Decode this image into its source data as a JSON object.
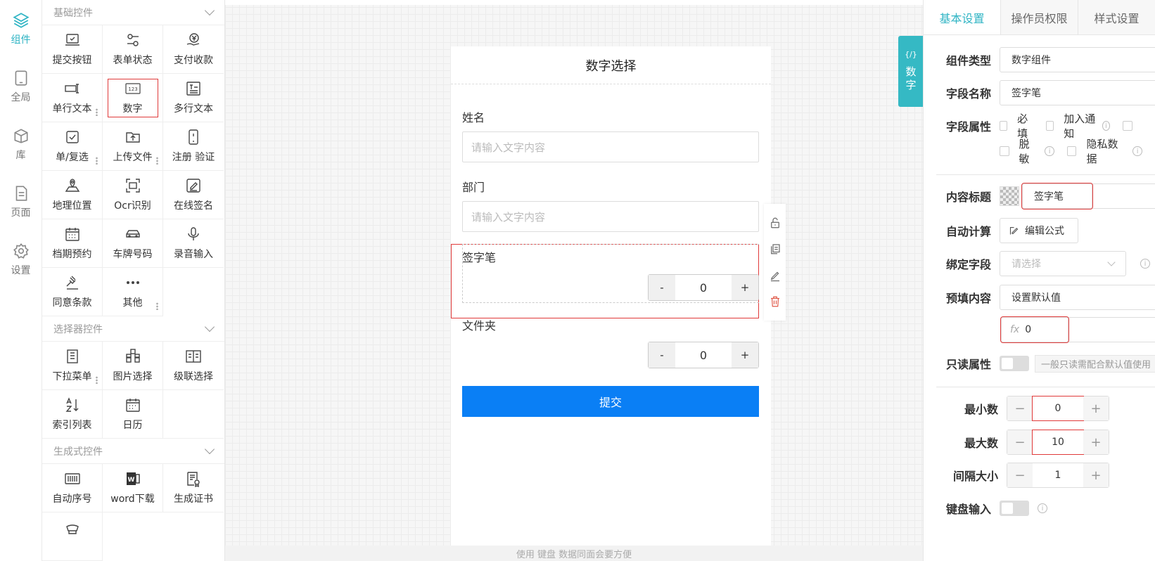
{
  "rail": [
    {
      "label": "组件",
      "icon": "layers-icon",
      "active": true
    },
    {
      "label": "全局",
      "icon": "tablet-icon"
    },
    {
      "label": "库",
      "icon": "box-icon"
    },
    {
      "label": "页面",
      "icon": "file-icon"
    },
    {
      "label": "设置",
      "icon": "gear-icon"
    }
  ],
  "palette": {
    "basic_title": "基础控件",
    "basic": [
      "提交按钮",
      "表单状态",
      "支付收款",
      "单行文本",
      "数字",
      "多行文本",
      "单/复选",
      "上传文件",
      "注册 验证",
      "地理位置",
      "Ocr识别",
      "在线签名",
      "档期预约",
      "车牌号码",
      "录音输入",
      "同意条款",
      "其他"
    ],
    "selector_title": "选择器控件",
    "selector": [
      "下拉菜单",
      "图片选择",
      "级联选择",
      "索引列表",
      "日历"
    ],
    "gen_title": "生成式控件",
    "gen": [
      "自动序号",
      "word下载",
      "生成证书"
    ]
  },
  "form": {
    "title": "数字选择",
    "field1_label": "姓名",
    "field1_placeholder": "请输入文字内容",
    "field2_label": "部门",
    "field2_placeholder": "请输入文字内容",
    "field3_label": "签字笔",
    "field3_value": "0",
    "field4_label": "文件夹",
    "field4_value": "0",
    "minus": "-",
    "plus": "+",
    "submit": "提交"
  },
  "tag": {
    "code": "{/}",
    "line1": "数",
    "line2": "字"
  },
  "bottom_hint": "使用 键盘 数据同面会要方便",
  "props": {
    "tabs": [
      "基本设置",
      "操作员权限",
      "样式设置"
    ],
    "type_label": "组件类型",
    "type_value": "数字组件",
    "name_label": "字段名称",
    "name_value": "签字笔",
    "attr_label": "字段属性",
    "attr_required": "必填",
    "attr_notify": "加入通知",
    "attr_mask": "脱敏",
    "attr_private": "隐私数据",
    "title_label": "内容标题",
    "title_value": "签字笔",
    "calc_label": "自动计算",
    "calc_button": "编辑公式",
    "bind_label": "绑定字段",
    "bind_placeholder": "请选择",
    "prefill_label": "预填内容",
    "prefill_value": "设置默认值",
    "fx_label": "fx",
    "fx_value": "0",
    "readonly_label": "只读属性",
    "readonly_hint": "一般只读需配合默认值使用",
    "min_label": "最小数",
    "min_value": "0",
    "max_label": "最大数",
    "max_value": "10",
    "step_label": "间隔大小",
    "step_value": "1",
    "keyboard_label": "键盘输入",
    "minus": "−",
    "plus": "+",
    "info": "i"
  }
}
